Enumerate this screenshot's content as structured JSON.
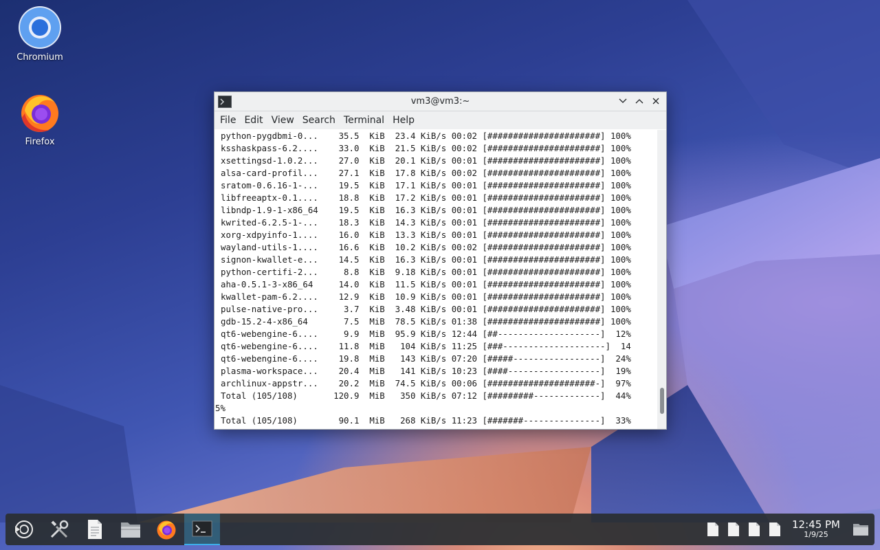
{
  "desktop": {
    "icons": [
      {
        "label": "Chromium",
        "icon": "chromium-icon"
      },
      {
        "label": "Firefox",
        "icon": "firefox-icon"
      }
    ]
  },
  "window": {
    "title": "vm3@vm3:~",
    "menu": [
      "File",
      "Edit",
      "View",
      "Search",
      "Terminal",
      "Help"
    ],
    "scroll_position": 0.95,
    "lines": [
      " python-pygdbmi-0...    35.5  KiB  23.4 KiB/s 00:02 [######################] 100%",
      " ksshaskpass-6.2....    33.0  KiB  21.5 KiB/s 00:02 [######################] 100%",
      " xsettingsd-1.0.2...    27.0  KiB  20.1 KiB/s 00:01 [######################] 100%",
      " alsa-card-profil...    27.1  KiB  17.8 KiB/s 00:02 [######################] 100%",
      " sratom-0.6.16-1-...    19.5  KiB  17.1 KiB/s 00:01 [######################] 100%",
      " libfreeaptx-0.1....    18.8  KiB  17.2 KiB/s 00:01 [######################] 100%",
      " libndp-1.9-1-x86_64    19.5  KiB  16.3 KiB/s 00:01 [######################] 100%",
      " kwrited-6.2.5-1-...    18.3  KiB  14.3 KiB/s 00:01 [######################] 100%",
      " xorg-xdpyinfo-1....    16.0  KiB  13.3 KiB/s 00:01 [######################] 100%",
      " wayland-utils-1....    16.6  KiB  10.2 KiB/s 00:02 [######################] 100%",
      " signon-kwallet-e...    14.5  KiB  16.3 KiB/s 00:01 [######################] 100%",
      " python-certifi-2...     8.8  KiB  9.18 KiB/s 00:01 [######################] 100%",
      " aha-0.5.1-3-x86_64     14.0  KiB  11.5 KiB/s 00:01 [######################] 100%",
      " kwallet-pam-6.2....    12.9  KiB  10.9 KiB/s 00:01 [######################] 100%",
      " pulse-native-pro...     3.7  KiB  3.48 KiB/s 00:01 [######################] 100%",
      " gdb-15.2-4-x86_64       7.5  MiB  78.5 KiB/s 01:38 [######################] 100%",
      " qt6-webengine-6....     9.9  MiB  95.9 KiB/s 12:44 [##--------------------]  12%",
      " qt6-webengine-6....    11.8  MiB   104 KiB/s 11:25 [###--------------------]  14",
      " qt6-webengine-6....    19.8  MiB   143 KiB/s 07:20 [#####-----------------]  24%",
      " plasma-workspace...    20.4  MiB   141 KiB/s 10:23 [####------------------]  19%",
      " archlinux-appstr...    20.2  MiB  74.5 KiB/s 00:06 [#####################-]  97%",
      " Total (105/108)       120.9  MiB   350 KiB/s 07:12 [#########-------------]  44%",
      "5%",
      " Total (105/108)        90.1  MiB   268 KiB/s 11:23 [#######---------------]  33%"
    ]
  },
  "taskbar": {
    "launchers": [
      "launcher-icon",
      "system-settings-icon",
      "text-editor-icon",
      "file-manager-icon",
      "firefox-icon",
      "terminal-icon"
    ],
    "clock": {
      "time": "12:45 PM",
      "date": "1/9/25"
    }
  }
}
